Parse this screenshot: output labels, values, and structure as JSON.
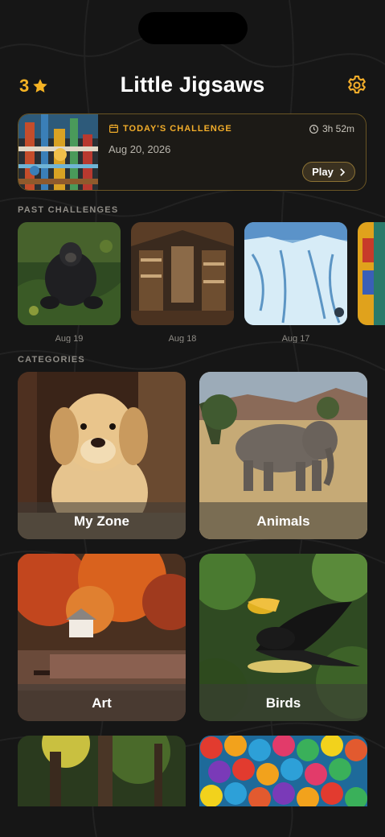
{
  "app": {
    "title": "Little Jigsaws"
  },
  "header": {
    "star_count": "3"
  },
  "challenge": {
    "label": "TODAY'S CHALLENGE",
    "date": "Aug 20, 2026",
    "timer": "3h 52m",
    "play_label": "Play"
  },
  "past": {
    "heading": "PAST CHALLENGES",
    "items": [
      {
        "date": "Aug 19"
      },
      {
        "date": "Aug 18"
      },
      {
        "date": "Aug 17"
      }
    ]
  },
  "categories": {
    "heading": "CATEGORIES",
    "items": [
      {
        "label": "My Zone"
      },
      {
        "label": "Animals"
      },
      {
        "label": "Art"
      },
      {
        "label": "Birds"
      },
      {
        "label": ""
      },
      {
        "label": ""
      }
    ]
  },
  "colors": {
    "accent": "#f2ad2a",
    "background": "#161616",
    "muted": "#8f8c86"
  },
  "icons": {
    "star": "star-icon",
    "settings": "gear-icon",
    "calendar": "calendar-icon",
    "clock": "clock-icon",
    "chevron": "chevron-right-icon"
  }
}
